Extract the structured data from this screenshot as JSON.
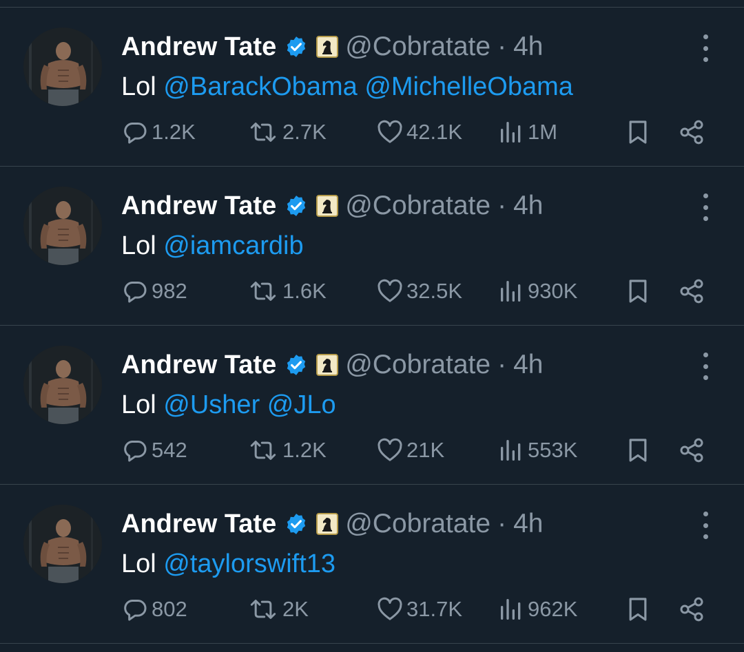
{
  "colors": {
    "background": "#15202b",
    "divider": "#38444d",
    "secondary_text": "#8b98a5",
    "mention_link": "#1d9bf0",
    "verified_badge": "#1d9bf0"
  },
  "tweets": [
    {
      "author_name": "Andrew Tate",
      "handle": "@Cobratate",
      "separator": "·",
      "time": "4h",
      "text_prefix": "Lol",
      "mentions": [
        "@BarackObama",
        "@MichelleObama"
      ],
      "replies": "1.2K",
      "retweets": "2.7K",
      "likes": "42.1K",
      "views": "1M"
    },
    {
      "author_name": "Andrew Tate",
      "handle": "@Cobratate",
      "separator": "·",
      "time": "4h",
      "text_prefix": "Lol",
      "mentions": [
        "@iamcardib"
      ],
      "replies": "982",
      "retweets": "1.6K",
      "likes": "32.5K",
      "views": "930K"
    },
    {
      "author_name": "Andrew Tate",
      "handle": "@Cobratate",
      "separator": "·",
      "time": "4h",
      "text_prefix": "Lol",
      "mentions": [
        "@Usher",
        "@JLo"
      ],
      "replies": "542",
      "retweets": "1.2K",
      "likes": "21K",
      "views": "553K"
    },
    {
      "author_name": "Andrew Tate",
      "handle": "@Cobratate",
      "separator": "·",
      "time": "4h",
      "text_prefix": "Lol",
      "mentions": [
        "@taylorswift13"
      ],
      "replies": "802",
      "retweets": "2K",
      "likes": "31.7K",
      "views": "962K"
    }
  ],
  "icons": {
    "verified": "verified-badge-icon",
    "affiliate": "chess-knight-icon",
    "more": "more-vertical-icon",
    "reply": "reply-icon",
    "retweet": "retweet-icon",
    "like": "like-icon",
    "views": "views-icon",
    "bookmark": "bookmark-icon",
    "share": "share-icon"
  }
}
